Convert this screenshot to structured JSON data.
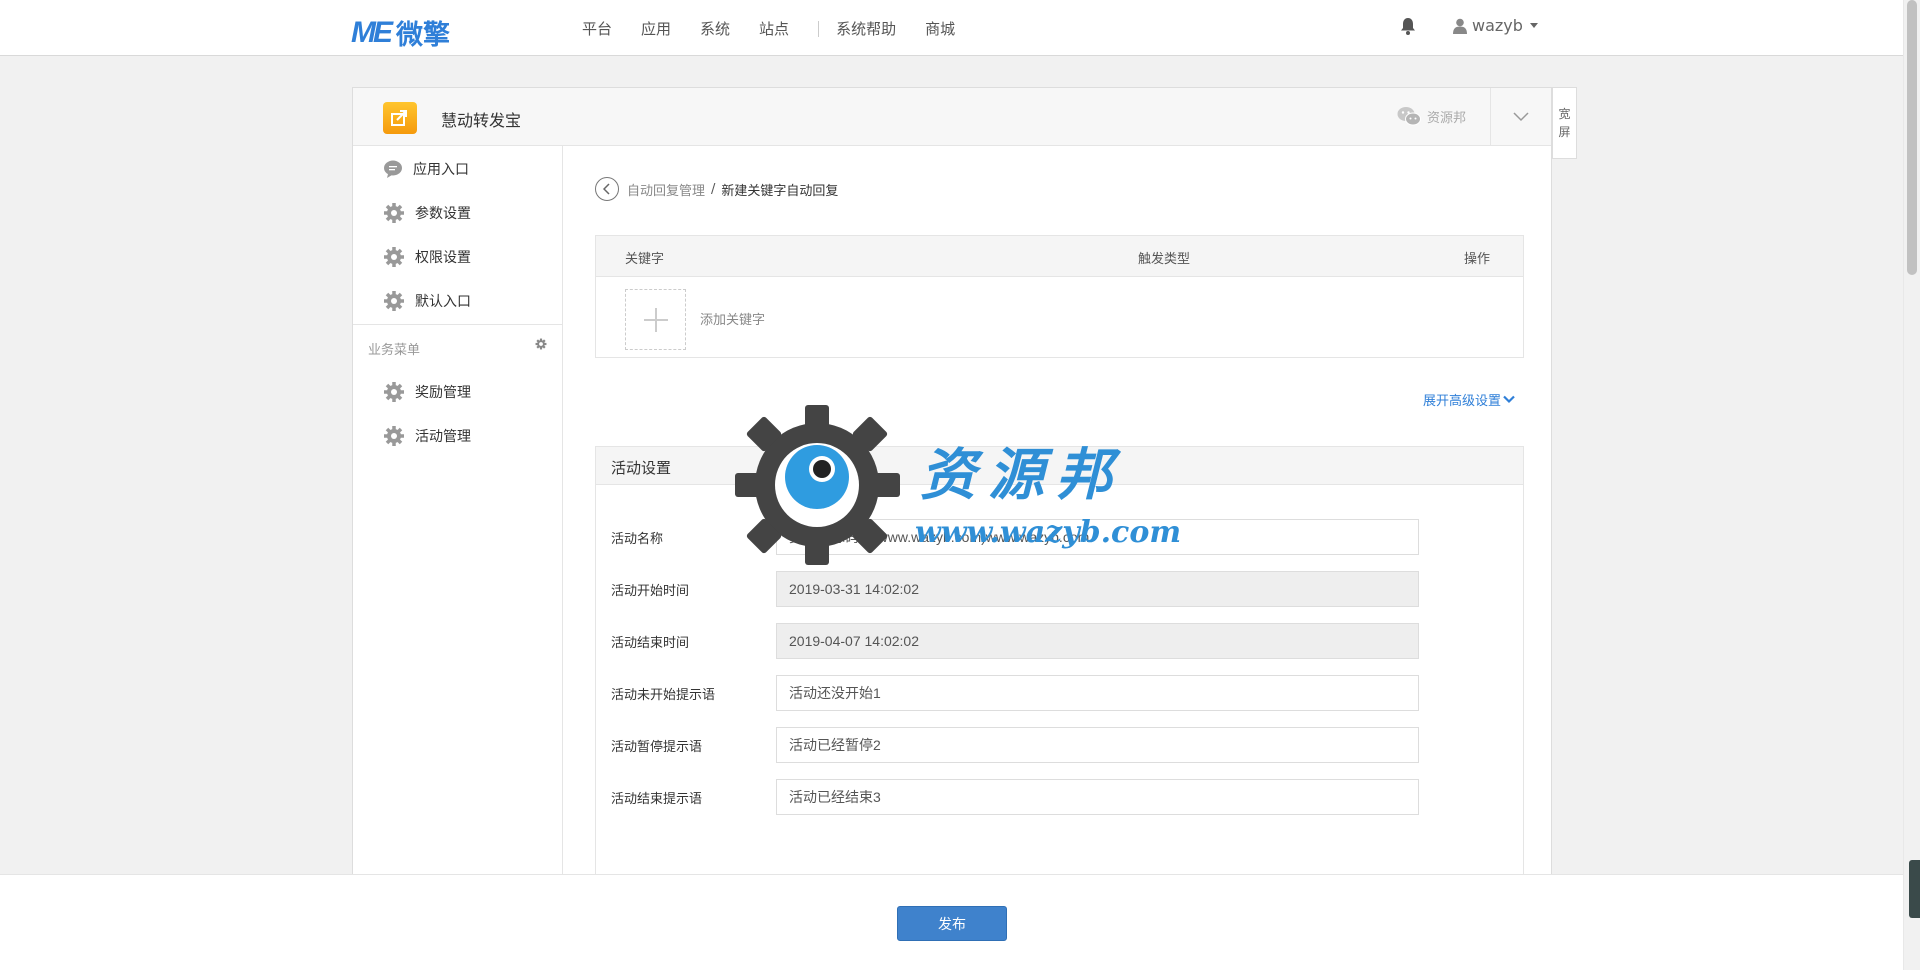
{
  "topnav": {
    "logo_mark": "ME",
    "logo_text": "微擎",
    "links": [
      "平台",
      "应用",
      "系统",
      "站点",
      "系统帮助",
      "商城"
    ],
    "username": "wazyb"
  },
  "panel": {
    "app_title": "慧动转发宝",
    "account_name": "资源邦",
    "wide_label_1": "宽",
    "wide_label_2": "屏"
  },
  "sidebar": {
    "items": [
      "应用入口",
      "参数设置",
      "权限设置",
      "默认入口"
    ],
    "section_title": "业务菜单",
    "business_items": [
      "奖励管理",
      "活动管理"
    ]
  },
  "breadcrumb": {
    "parent": "自动回复管理",
    "separator": "/",
    "current": "新建关键字自动回复"
  },
  "keyword_table": {
    "columns": [
      "关键字",
      "触发类型",
      "操作"
    ],
    "add_label": "添加关键字"
  },
  "advanced_link": "展开高级设置",
  "settings": {
    "title": "活动设置",
    "rows": [
      {
        "label": "活动名称",
        "value": "资源邦源码网(www.wazyb.com)www.wazyb.com",
        "readonly": false
      },
      {
        "label": "活动开始时间",
        "value": "2019-03-31 14:02:02",
        "readonly": true
      },
      {
        "label": "活动结束时间",
        "value": "2019-04-07 14:02:02",
        "readonly": true
      },
      {
        "label": "活动未开始提示语",
        "value": "活动还没开始1",
        "readonly": false
      },
      {
        "label": "活动暂停提示语",
        "value": "活动已经暂停2",
        "readonly": false
      },
      {
        "label": "活动结束提示语",
        "value": "活动已经结束3",
        "readonly": false
      }
    ]
  },
  "watermark": {
    "title": "资源邦",
    "url": "www.wazyb.com"
  },
  "publish_label": "发布",
  "colors": {
    "accent": "#2f7fd8",
    "button": "#3f82cc",
    "app_icon": "#f5a623"
  }
}
